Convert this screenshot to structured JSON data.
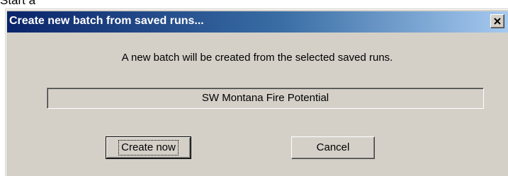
{
  "background": {
    "partial_text": "Start a"
  },
  "dialog": {
    "title": "Create new batch from saved runs...",
    "message": "A new batch will be created from the selected saved runs.",
    "batch_name": "SW Montana Fire Potential",
    "close_icon": "close-icon",
    "buttons": {
      "create_label": "Create now",
      "cancel_label": "Cancel"
    }
  },
  "colors": {
    "titlebar_start": "#0a246a",
    "titlebar_end": "#a6caf0",
    "dialog_face": "#d4d0c8"
  }
}
